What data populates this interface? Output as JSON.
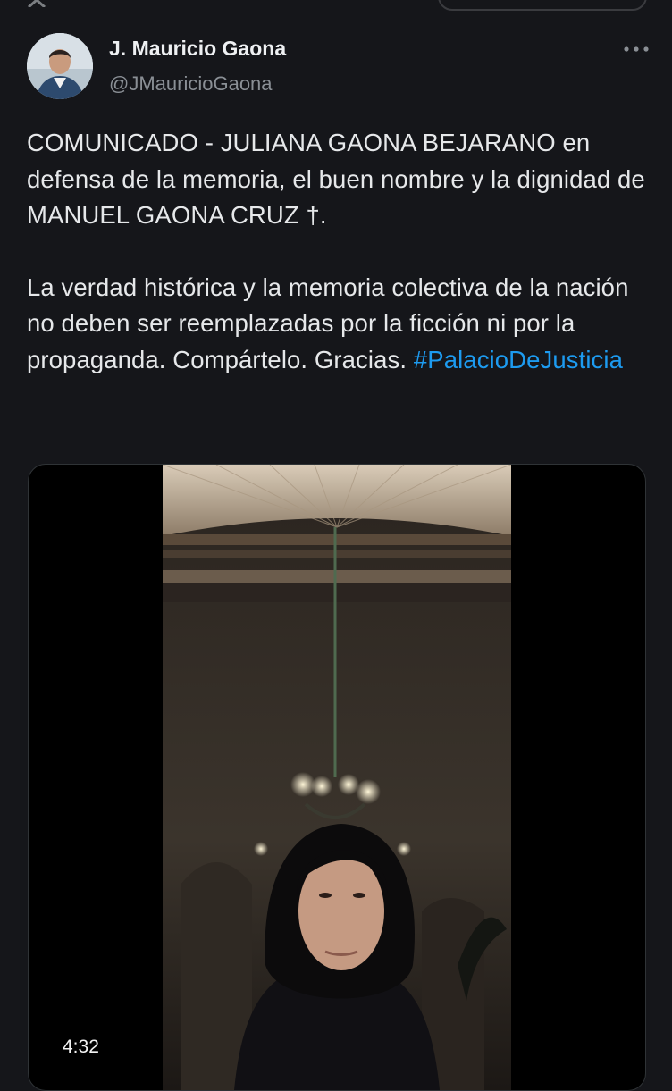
{
  "topbar": {
    "logo_icon": "x-logo-icon"
  },
  "author": {
    "name": "J. Mauricio Gaona",
    "handle": "@JMauricioGaona",
    "avatar_icon": "user-avatar",
    "more_icon": "more-options-icon"
  },
  "tweet": {
    "paragraph1": "COMUNICADO - JULIANA GAONA BEJARANO en defensa de la memoria, el buen nombre y la dignidad de MANUEL GAONA CRUZ †.",
    "paragraph2": "La verdad histórica y la memoria colectiva de la nación no deben ser reemplazadas por la ficción ni por la propaganda.  Compártelo. Gracias.",
    "hashtag": "#PalacioDeJusticia"
  },
  "media": {
    "type": "video",
    "duration": "4:32"
  },
  "colors": {
    "background": "#15161a",
    "text": "#e6e8ea",
    "secondary": "#8a8f95",
    "link": "#1d9bf0"
  }
}
